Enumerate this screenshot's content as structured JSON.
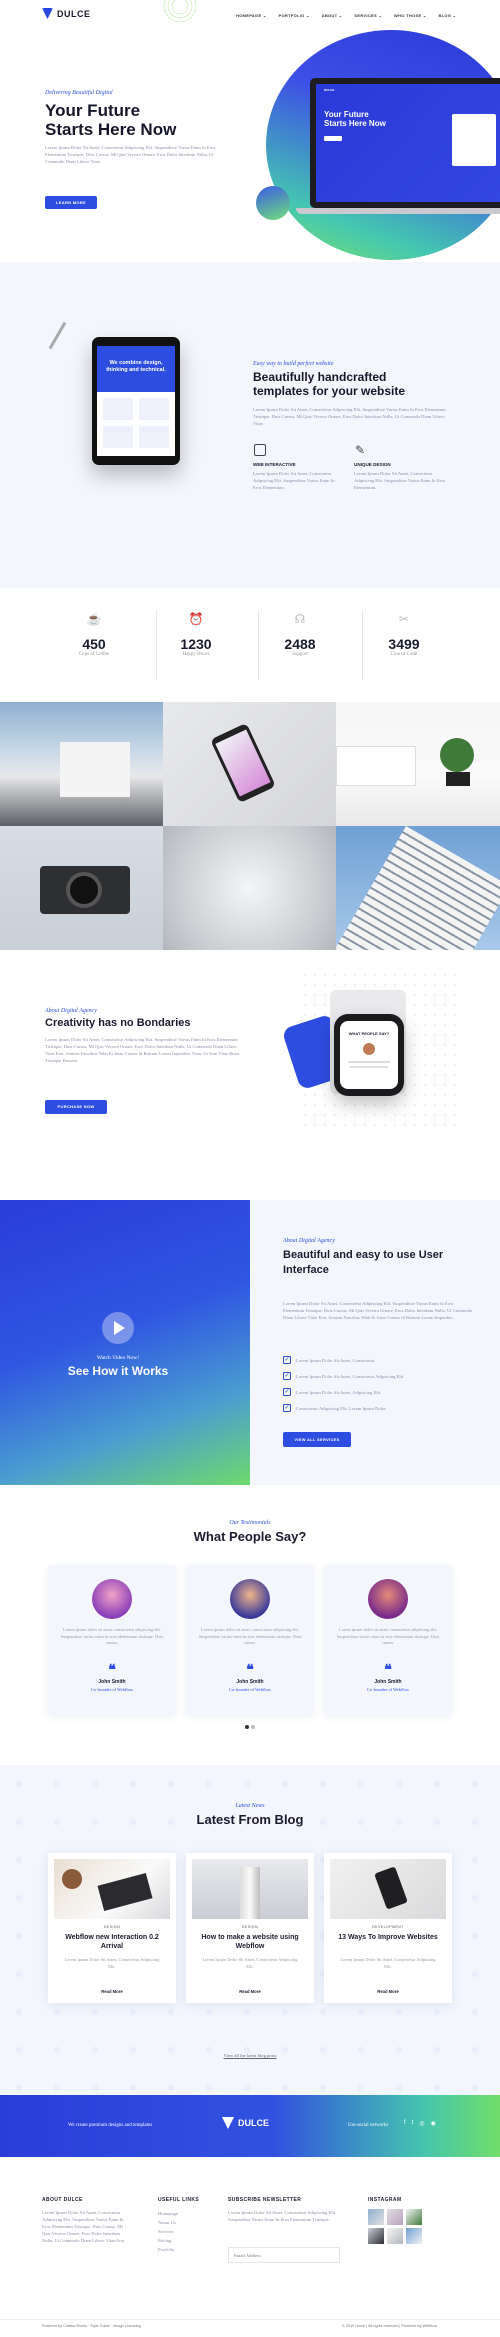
{
  "header": {
    "logo": "DULCE",
    "menu": [
      "HOMEPAGE ⌄",
      "PORTFOLIO ⌄",
      "ABOUT ⌄",
      "SERVICES ⌄",
      "WHO THOSE ⌄",
      "BLOG ⌄"
    ]
  },
  "hero": {
    "eyebrow": "Delivering Beautiful Digital",
    "title_line1": "Your Future",
    "title_line2": "Starts Here Now",
    "text": "Lorem Ipsum Dolor Sit Amet, Consectetur Adipiscing Elit. Suspendisse Varius Enim In Eros Elementum Tristique. Duis Cursus, Mi Quis Viverra Ornare, Eros Dolor Interdum Nulla, Ut Commodo Diam Libero Vitae.",
    "button": "LEARN MORE",
    "screen_title_1": "Your Future",
    "screen_title_2": "Starts Here Now"
  },
  "templates": {
    "eyebrow": "Easy way to build perfect website",
    "title_line1": "Beautifully handcrafted",
    "title_line2": "templates for your website",
    "text": "Lorem Ipsum Dolor Sit Amet, Consectetur Adipiscing Elit. Suspendisse Varius Enim In Eros Elementum Tristique. Duis Cursus, Mi Quis Viverra Ornare, Eros Dolor Interdum Nulla, Ut Commodo Diam Libero Vitae.",
    "tablet_headline": "We combine design, thinking and technical.",
    "features": [
      {
        "title": "WEB INTERACTIVE",
        "text": "Lorem Ipsum Dolor Sit Amet, Consectetur Adipiscing Elit. Suspendisse Varius Enim In Eros Elementum."
      },
      {
        "title": "UNIQUE DESIGN",
        "text": "Lorem Ipsum Dolor Sit Amet, Consectetur Adipiscing Elit. Suspendisse Varius Enim In Eros Elementum."
      }
    ]
  },
  "stats": [
    {
      "value": "450",
      "label": "Cups of Coffee",
      "icon": "coffee-icon"
    },
    {
      "value": "1230",
      "label": "Happy Hours",
      "icon": "clock-icon"
    },
    {
      "value": "2488",
      "label": "Support",
      "icon": "headset-icon"
    },
    {
      "value": "3499",
      "label": "Line of Code",
      "icon": "code-icon"
    }
  ],
  "agency": {
    "eyebrow": "About Digital Agency",
    "title": "Creativity has no Bondaries",
    "text": "Lorem Ipsum Dolor Sit Amet, Consectetur Adipiscing Elit. Suspendisse Varius Enim In Eros Elementum Tristique. Duis Cursus, Mi Quis Viverra Ornare, Eros Dolor Interdum Nulla, Ut Commodo Diam Libero Vitae Erat. Aenean Faucibus Nibh Et Justo Cursus Id Rutrum Lorem Imperdiet. Nunc Ut Sem Vitae Risus Tristique Posuere.",
    "button": "PURCHASE NOW",
    "watch_title": "WHAT PEOPLE SAY?"
  },
  "video": {
    "eyebrow": "Watch Video Now!",
    "title": "See How it Works",
    "about_eyebrow": "About Digital Agency",
    "about_title_1": "Beautiful and easy to use User",
    "about_title_2": "Interface",
    "about_text": "Lorem Ipsum Dolor Sit Amet, Consectetur Adipiscing Elit. Suspendisse Varius Enim In Eros Elementum Tristique. Duis Cursus, Mi Quis Viverra Ornare, Eros Dolor Interdum Nulla, Ut Commodo Diam Libero Vitae Erat. Aenean Faucibus Nibh Et Justo Cursus Id Rutrum Lorem Imperdiet.",
    "checks": [
      "Lorem Ipsum Dolor Sit Amet, Consectetur.",
      "Lorem Ipsum Dolor Sit Amet, Consectetur Adipiscing Elit.",
      "Lorem Ipsum Dolor Sit Amet, Adipiscing Elit.",
      "Consectetur Adipiscing Elit. Lorem Ipsum Dolor."
    ],
    "button": "VIEW ALL SERVICES"
  },
  "testimonials": {
    "eyebrow": "Our Testimonials",
    "title": "What People Say?",
    "items": [
      {
        "text": "Lorem ipsum dolor sit amet, consectetur adipiscing elit. Suspendisse varius enim in eros elementum tristique. Duis cursus.",
        "name": "John Smith",
        "role": "Co-founder of Webflow"
      },
      {
        "text": "Lorem ipsum dolor sit amet, consectetur adipiscing elit. Suspendisse varius enim in eros elementum tristique. Duis cursus.",
        "name": "John Smith",
        "role": "Co-founder of Webflow"
      },
      {
        "text": "Lorem ipsum dolor sit amet, consectetur adipiscing elit. Suspendisse varius enim in eros elementum tristique. Duis cursus.",
        "name": "John Smith",
        "role": "Co-founder of Webflow"
      }
    ]
  },
  "blog": {
    "eyebrow": "Latest News",
    "title": "Latest From Blog",
    "posts": [
      {
        "category": "DESIGN",
        "title": "Webflow new Interaction 0.2 Arrival",
        "text": "Lorem Ipsum Dolor Sit Amet, Consectetur Adipiscing Elit.",
        "more": "Read More"
      },
      {
        "category": "DESIGN",
        "title": "How to make a website using Webflow",
        "text": "Lorem Ipsum Dolor Sit Amet, Consectetur Adipiscing Elit.",
        "more": "Read More"
      },
      {
        "category": "DEVELOPMENT",
        "title": "13 Ways To Improve Websites",
        "text": "Lorem Ipsum Dolor Sit Amet, Consectetur Adipiscing Elit.",
        "more": "Read More"
      }
    ],
    "view_all": "View all the latest blog posts"
  },
  "cta": {
    "left": "We create premium designs and templates",
    "logo": "DULCE",
    "right": "Use social networks"
  },
  "footer": {
    "about_title": "ABOUT DULCE",
    "about_text": "Lorem Ipsum Dolor Sit Amet, Consectetur Adipiscing Elit. Suspendisse Varius Enim In Eros Elementum Tristique. Duis Cursus, Mi Quis Viverra Ornare, Eros Dolor Interdum Nulla, Ut Commodo Diam Libero Vitae Erat.",
    "links_title": "USEFUL LINKS",
    "links": [
      "Homepage",
      "About Us",
      "Services",
      "Pricing",
      "Portfolio"
    ],
    "newsletter_title": "SUBSCRIBE NEWSLETTER",
    "newsletter_text": "Lorem Ipsum Dolor Sit Amet, Consectetur Adipiscing Elit. Suspendisse Varius Enim In Eros Elementum Tristique.",
    "newsletter_placeholder": "Email Address",
    "instagram_title": "INSTAGRAM",
    "bottom_left": "Powered by Clarisa Studio · Style Guide · Image Licensing",
    "bottom_right": "© 2019 Dulce | All rights reserved | Powered by Webflow"
  },
  "colors": {
    "accent": "#2d4de0",
    "green": "#6fdc6a",
    "dark": "#17172b"
  }
}
